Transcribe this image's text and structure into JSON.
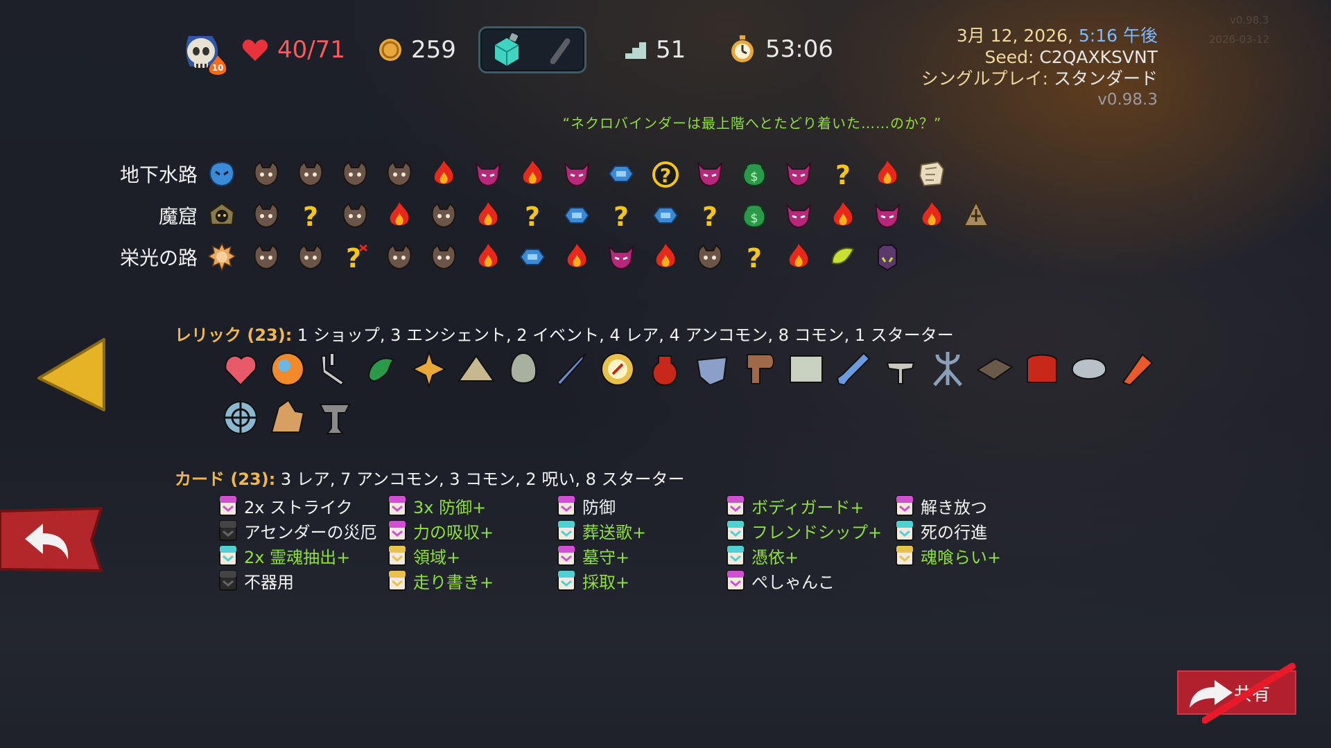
{
  "topbar": {
    "ascension_level": "10",
    "hp": "40/71",
    "gold": "259",
    "floor": "51",
    "time": "53:06"
  },
  "info": {
    "date_prefix": "3月 12, 2026, ",
    "time": "5:16 午後",
    "seed_label": "Seed: ",
    "seed": "C2QAXKSVNT",
    "mode_label": "シングルプレイ: ",
    "mode": "スタンダード",
    "version": "v0.98.3",
    "faint_version": "v0.98.3",
    "faint_date": "2026-03-12"
  },
  "quote": "“ネクロバインダーは最上階へとたどり着いた……のか？”",
  "acts": [
    {
      "name": "地下水路",
      "nodes": [
        "boss-blue",
        "monster",
        "monster",
        "monster",
        "monster",
        "rest",
        "elite",
        "rest",
        "elite",
        "treasure",
        "unknown-gold",
        "elite",
        "shop",
        "elite",
        "unknown",
        "rest",
        "ancient"
      ]
    },
    {
      "name": "魔窟",
      "nodes": [
        "boss-dark",
        "monster",
        "unknown",
        "monster",
        "rest",
        "monster",
        "rest",
        "unknown",
        "treasure",
        "unknown",
        "treasure",
        "unknown",
        "shop",
        "elite",
        "rest",
        "elite",
        "rest",
        "boss-ancient"
      ]
    },
    {
      "name": "栄光の路",
      "nodes": [
        "boss-spiky",
        "monster",
        "monster",
        "unknown-x",
        "monster",
        "monster",
        "rest",
        "treasure",
        "rest",
        "elite",
        "rest",
        "monster",
        "unknown",
        "rest",
        "event-green",
        "boss-purple"
      ]
    }
  ],
  "relics": {
    "label": "レリック (23):",
    "summary": " 1 ショップ,  3 エンシェント, 2 イベント, 4 レア, 4 アンコモン, 8 コモン, 1 スターター",
    "items": [
      "heart-relic",
      "orange-orb-relic",
      "tuning-fork-relic",
      "green-dragon-relic",
      "golden-vajra-relic",
      "tent-relic",
      "egg-relic",
      "sword-relic",
      "compass-relic",
      "red-flask-relic",
      "cape-relic",
      "hook-relic",
      "cradle-relic",
      "shovel-relic",
      "candelabra-relic",
      "trident-relic",
      "tablet-relic",
      "mailbox-relic",
      "stone-relic",
      "megaphone-relic",
      "wheel-relic",
      "crystal-relic",
      "anvil-relic"
    ]
  },
  "cards": {
    "label": "カード (23):",
    "summary": " 3 レア, 7 アンコモン, 3 コモン, 2 呪い, 8 スターター",
    "items": [
      {
        "name": "2x ストライク",
        "color": "white",
        "icon": "#d14fd1"
      },
      {
        "name": "アセンダーの災厄",
        "color": "white",
        "icon": "#222"
      },
      {
        "name": "2x 霊魂抽出+",
        "color": "green",
        "icon": "#4fd1d1"
      },
      {
        "name": "不器用",
        "color": "white",
        "icon": "#222"
      },
      {
        "name": "3x 防御+",
        "color": "green",
        "icon": "#d14fd1"
      },
      {
        "name": "力の吸収+",
        "color": "green",
        "icon": "#d14fd1"
      },
      {
        "name": "領域+",
        "color": "green",
        "icon": "#e8c34a"
      },
      {
        "name": "走り書き+",
        "color": "green",
        "icon": "#e8c34a"
      },
      {
        "name": "防御",
        "color": "white",
        "icon": "#d14fd1"
      },
      {
        "name": "葬送歌+",
        "color": "green",
        "icon": "#4fd1d1"
      },
      {
        "name": "墓守+",
        "color": "green",
        "icon": "#d14fd1"
      },
      {
        "name": "採取+",
        "color": "green",
        "icon": "#4fd1d1"
      },
      {
        "name": "ボディガード+",
        "color": "green",
        "icon": "#d14fd1"
      },
      {
        "name": "フレンドシップ+",
        "color": "green",
        "icon": "#4fd1d1"
      },
      {
        "name": "憑依+",
        "color": "green",
        "icon": "#4fd1d1"
      },
      {
        "name": "ぺしゃんこ",
        "color": "white",
        "icon": "#d14fd1"
      },
      {
        "name": "解き放つ",
        "color": "white",
        "icon": "#d14fd1"
      },
      {
        "name": "死の行進",
        "color": "white",
        "icon": "#4fd1d1"
      },
      {
        "name": "魂喰らい+",
        "color": "green",
        "icon": "#e8c34a"
      }
    ]
  },
  "share_label": "共有"
}
